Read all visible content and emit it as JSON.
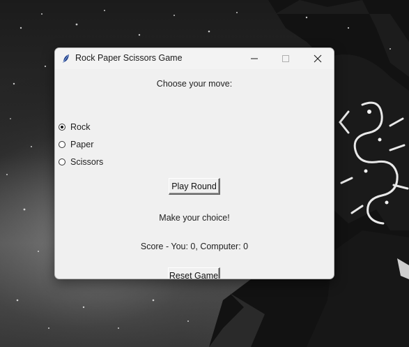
{
  "window": {
    "title": "Rock Paper Scissors Game",
    "minimize_icon": "minimize-icon",
    "maximize_icon": "maximize-icon",
    "close_icon": "close-icon"
  },
  "game": {
    "prompt": "Choose your move:",
    "options": [
      {
        "label": "Rock",
        "selected": true
      },
      {
        "label": "Paper",
        "selected": false
      },
      {
        "label": "Scissors",
        "selected": false
      }
    ],
    "play_button": "Play Round",
    "status": "Make your choice!",
    "score": "Score - You: 0, Computer: 0",
    "reset_button": "Reset Game"
  }
}
